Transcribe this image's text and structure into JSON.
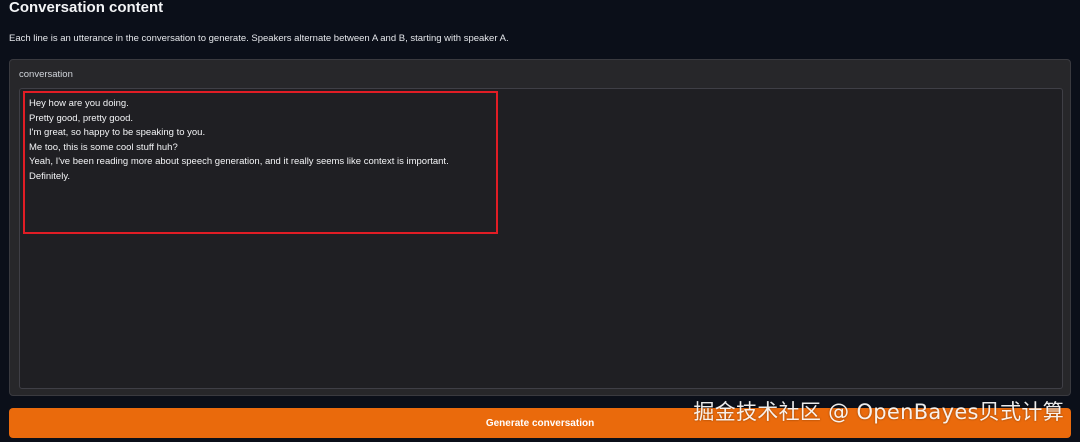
{
  "section": {
    "title": "Conversation content",
    "description": "Each line is an utterance in the conversation to generate. Speakers alternate between A and B, starting with speaker A."
  },
  "conversation_field": {
    "label": "conversation",
    "value": "Hey how are you doing.\nPretty good, pretty good.\nI'm great, so happy to be speaking to you.\nMe too, this is some cool stuff huh?\nYeah, I've been reading more about speech generation, and it really seems like context is important.\nDefinitely."
  },
  "actions": {
    "generate_label": "Generate conversation"
  },
  "watermark": {
    "text": "掘金技术社区 @ OpenBayes贝式计算"
  },
  "colors": {
    "page_background": "#0b0f19",
    "panel_background": "#27272a",
    "textarea_background": "#1f1f23",
    "button_primary": "#ea6a0c",
    "highlight_border": "#e11d25"
  }
}
